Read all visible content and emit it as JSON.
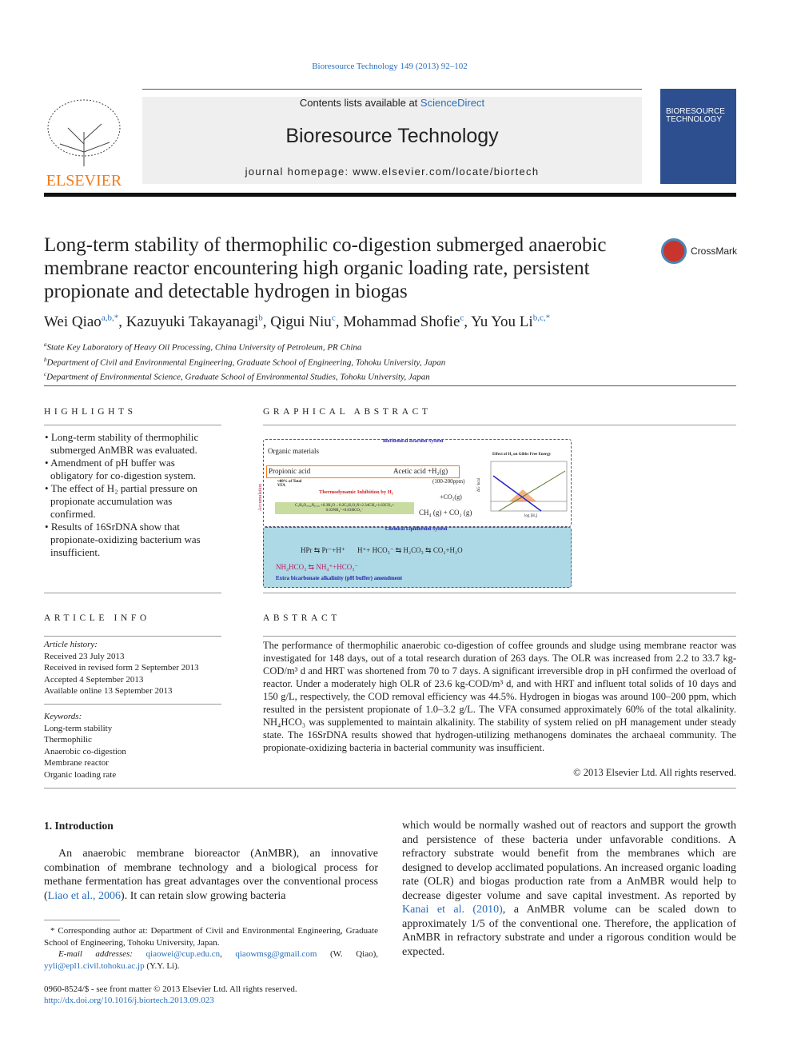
{
  "journal_ref": "Bioresource Technology 149 (2013) 92–102",
  "header": {
    "contents_prefix": "Contents lists available at ",
    "sciencedirect": "ScienceDirect",
    "journal": "Bioresource Technology",
    "homepage": "journal homepage: www.elsevier.com/locate/biortech",
    "publisher": "ELSEVIER",
    "cover_title": "BIORESOURCE TECHNOLOGY"
  },
  "title": "Long-term stability of thermophilic co-digestion submerged anaerobic membrane reactor encountering high organic loading rate, persistent propionate and detectable hydrogen in biogas",
  "crossmark": "CrossMark",
  "authors": [
    {
      "name": "Wei Qiao",
      "sup": "a,b,*"
    },
    {
      "name": "Kazuyuki Takayanagi",
      "sup": "b"
    },
    {
      "name": "Qigui Niu",
      "sup": "c"
    },
    {
      "name": "Mohammad Shofie",
      "sup": "c"
    },
    {
      "name": "Yu You Li",
      "sup": "b,c,*"
    }
  ],
  "affiliations": [
    {
      "sup": "a",
      "text": "State Key Laboratory of Heavy Oil Processing, China University of Petroleum, PR China"
    },
    {
      "sup": "b",
      "text": "Department of Civil and Environmental Engineering, Graduate School of Engineering, Tohoku University, Japan"
    },
    {
      "sup": "c",
      "text": "Department of Environmental Science, Graduate School of Environmental Studies, Tohoku University, Japan"
    }
  ],
  "highlights": {
    "heading": "HIGHLIGHTS",
    "items": [
      "Long-term stability of thermophilic submerged AnMBR was evaluated.",
      "Amendment of pH buffer was obligatory for co-digestion system.",
      "The effect of H₂ partial pressure on propionate accumulation was confirmed.",
      "Results of 16SrDNA show that propionate-oxidizing bacterium was insufficient."
    ]
  },
  "graphical_abstract": {
    "heading": "GRAPHICAL ABSTRACT",
    "bio_system": "Biochemical Reaction System",
    "chem_system": "Chemical Equilibrium System",
    "organic": "Organic materials",
    "propionic": "Propionic acid",
    "acetic": "Acetic acid +H₂(g)",
    "ppm": "(100-200ppm)",
    "vfa": "≈80% of Total VFA",
    "inhibition": "Thermodynamic Inhibition by H₂",
    "accumulation": "Accumulation",
    "co2": "+CO₂(g)",
    "products": "CH₄ (g) + CO₂ (g)",
    "equation": "C₅H₉O₂.₆₂N₀.₂₃ +0.3H₂O→0.2C₅H₇O₂N+2.34CH₄+1.63CO₂+ 0.03NH₄⁺+0.03HCO₃⁻",
    "eq1": "HPr ⇆ Pr⁻+H⁺",
    "eq2": "H⁺+ HCO₃⁻ ⇆ H₂CO₃ ⇆ CO₂+H₂O",
    "eq3": "NH₄HCO₃ ⇆ NH₄⁺+HCO₃⁻",
    "amendment": "Extra bicarbonate alkalinity (pH buffer) amendment",
    "chart_title": "Effect of H₂ on Gibbs Free Energy",
    "chart_xlabel": "log [H₂]",
    "chart_ylabel": "ΔG' kcal"
  },
  "article_info": {
    "heading": "ARTICLE INFO",
    "history_label": "Article history:",
    "history": [
      "Received 23 July 2013",
      "Received in revised form 2 September 2013",
      "Accepted 4 September 2013",
      "Available online 13 September 2013"
    ],
    "keywords_label": "Keywords:",
    "keywords": [
      "Long-term stability",
      "Thermophilic",
      "Anaerobic co-digestion",
      "Membrane reactor",
      "Organic loading rate"
    ]
  },
  "abstract": {
    "heading": "ABSTRACT",
    "text": "The performance of thermophilic anaerobic co-digestion of coffee grounds and sludge using membrane reactor was investigated for 148 days, out of a total research duration of 263 days. The OLR was increased from 2.2 to 33.7 kg-COD/m³ d and HRT was shortened from 70 to 7 days. A significant irreversible drop in pH confirmed the overload of reactor. Under a moderately high OLR of 23.6 kg-COD/m³ d, and with HRT and influent total solids of 10 days and 150 g/L, respectively, the COD removal efficiency was 44.5%. Hydrogen in biogas was around 100–200 ppm, which resulted in the persistent propionate of 1.0–3.2 g/L. The VFA consumed approximately 60% of the total alkalinity. NH₄HCO₃ was supplemented to maintain alkalinity. The stability of system relied on pH management under steady state. The 16SrDNA results showed that hydrogen-utilizing methanogens dominates the archaeal community. The propionate-oxidizing bacteria in bacterial community was insufficient.",
    "copyright": "© 2013 Elsevier Ltd. All rights reserved."
  },
  "intro": {
    "heading": "1. Introduction",
    "p1_a": "An anaerobic membrane bioreactor (AnMBR), an innovative combination of membrane technology and a biological process for methane fermentation has great advantages over the conventional process (",
    "ref1": "Liao et al., 2006",
    "p1_b": "). It can retain slow growing bacteria",
    "col2_a": "which would be normally washed out of reactors and support the growth and persistence of these bacteria under unfavorable conditions. A refractory substrate would benefit from the membranes which are designed to develop acclimated populations. An increased organic loading rate (OLR) and biogas production rate from a AnMBR would help to decrease digester volume and save capital investment. As reported by ",
    "ref2": "Kanai et al. (2010)",
    "col2_b": ", a AnMBR volume can be scaled down to approximately 1/5 of the conventional one. Therefore, the application of AnMBR in refractory substrate and under a rigorous condition would be expected."
  },
  "footnote": {
    "corresponding": "* Corresponding author at: Department of Civil and Environmental Engineering, Graduate School of Engineering, Tohoku University, Japan.",
    "email_label": "E-mail addresses: ",
    "email1": "qiaowei@cup.edu.cn",
    "email2": "qiaowmsg@gmail.com",
    "email1_owner": " (W. Qiao), ",
    "email3": "yyli@epl1.civil.tohoku.ac.jp",
    "email3_owner": " (Y.Y. Li).",
    "issn": "0960-8524/$ - see front matter © 2013 Elsevier Ltd. All rights reserved.",
    "doi": "http://dx.doi.org/10.1016/j.biortech.2013.09.023"
  },
  "colors": {
    "link": "#2a6ebb",
    "elsevier_orange": "#f07b1d",
    "cover": "#2d4f8f",
    "ga_panel": "#add8e6"
  }
}
